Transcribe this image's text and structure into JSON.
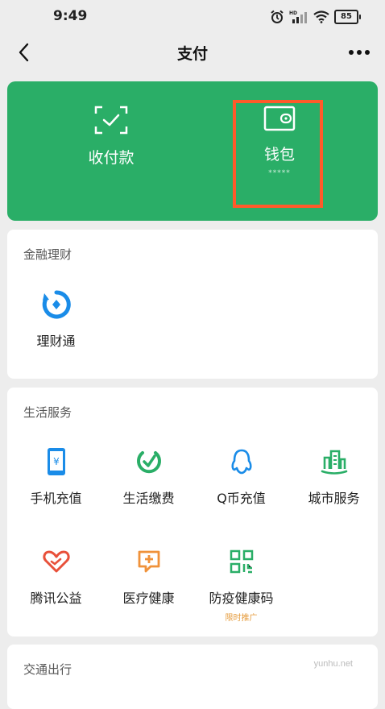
{
  "status_bar": {
    "time": "9:49",
    "battery": "85",
    "network": "HD"
  },
  "header": {
    "title": "支付",
    "back_icon": "chevron-left-icon",
    "more_icon": "more-dots-icon"
  },
  "hero": {
    "collect_label": "收付款",
    "wallet_label": "钱包",
    "wallet_mask": "*****",
    "bg_color": "#2aae67",
    "highlight_color": "#ff5a2a"
  },
  "finance": {
    "title": "金融理财",
    "items": [
      {
        "label": "理财通",
        "icon": "licaitong-icon"
      }
    ]
  },
  "life": {
    "title": "生活服务",
    "items": [
      {
        "label": "手机充值",
        "icon": "phone-topup-icon"
      },
      {
        "label": "生活缴费",
        "icon": "bill-payment-icon"
      },
      {
        "label": "Q币充值",
        "icon": "qq-coin-icon"
      },
      {
        "label": "城市服务",
        "icon": "city-service-icon"
      },
      {
        "label": "腾讯公益",
        "icon": "charity-heart-icon"
      },
      {
        "label": "医疗健康",
        "icon": "medical-icon"
      },
      {
        "label": "防疫健康码",
        "icon": "qr-code-icon",
        "badge": "限时推广"
      }
    ]
  },
  "transport": {
    "title": "交通出行"
  },
  "watermark": "yunhu.net"
}
